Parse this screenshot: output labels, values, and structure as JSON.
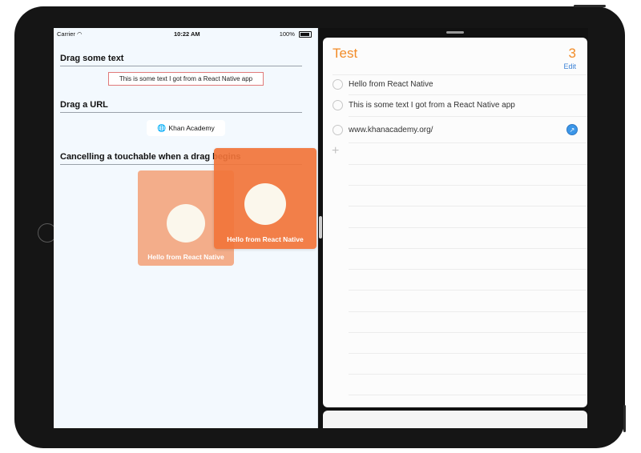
{
  "status_bar": {
    "carrier": "Carrier",
    "time": "10:22 AM",
    "battery": "100%"
  },
  "left_app": {
    "sections": [
      {
        "title": "Drag some text"
      },
      {
        "title": "Drag a URL"
      },
      {
        "title": "Cancelling a touchable when a drag begins"
      }
    ],
    "drag_text": "This is some text I got from a React Native app",
    "url_label": "Khan Academy",
    "tiles": [
      {
        "label": "Hello from React Native"
      },
      {
        "label": "Hello from React Native"
      }
    ]
  },
  "right_app": {
    "list_title": "Test",
    "count": "3",
    "edit_label": "Edit",
    "reminders": [
      {
        "text": "Hello from React Native"
      },
      {
        "text": "This is some text I got from a React Native app"
      },
      {
        "text": "www.khanacademy.org/"
      }
    ]
  },
  "icons": {
    "globe": "globe-icon",
    "safari": "safari-icon",
    "add": "plus-icon",
    "wifi": "wifi-icon"
  },
  "colors": {
    "accent_orange": "#f28c28",
    "tile_orange": "#f2743a",
    "tile_faded": "#f3ad8a",
    "link_blue": "#3b82d6",
    "left_bg": "#f3f9fe"
  }
}
